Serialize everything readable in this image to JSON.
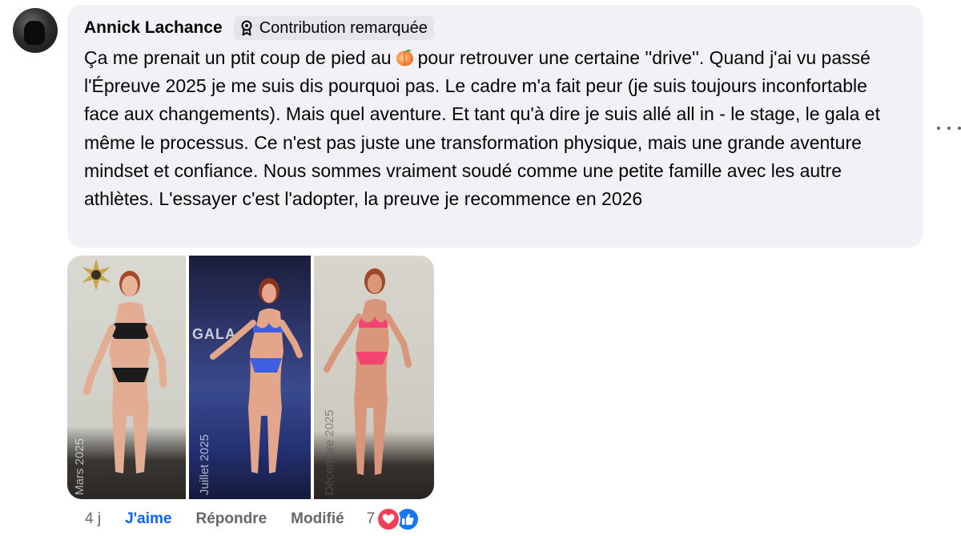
{
  "comment": {
    "author": "Annick Lachance",
    "badge_label": "Contribution remarquée",
    "text_before_emoji": "Ça me prenait un ptit coup de pied au",
    "emoji": "peach-emoji",
    "text_after_emoji": "pour retrouver une certaine ''drive''. Quand j'ai vu passé l'Épreuve 2025 je me suis dis pourquoi pas. Le cadre m'a fait peur (je suis toujours inconfortable face aux changements). Mais quel aventure. Et tant qu'à dire je suis allé all in - le stage, le gala et même le processus. Ce n'est pas juste une transformation physique, mais une grande aventure mindset et confiance. Nous sommes vraiment soudé comme une petite famille avec les autre athlètes. L'essayer c'est l'adopter, la preuve je recommence en 2026"
  },
  "photo": {
    "panels": [
      {
        "caption": "Mars 2025",
        "outfit_color": "#1b1b1b"
      },
      {
        "caption": "Juillet 2025",
        "outfit_color": "#3e5fe0",
        "sign_text": "GALA"
      },
      {
        "caption": "Décembre 2025",
        "outfit_color": "#f2446e"
      }
    ]
  },
  "actions": {
    "time": "4 j",
    "like_label": "J'aime",
    "reply_label": "Répondre",
    "edited_label": "Modifié",
    "reaction_count": "7"
  },
  "colors": {
    "bubble": "#f0f2f5",
    "badge": "#e4e6eb",
    "link_blue": "#0866ff",
    "secondary_text": "#65676b",
    "love": "#f33e58",
    "like": "#1877f2"
  },
  "icons": [
    "avatar",
    "badge-ribbon-icon",
    "more-options-icon",
    "heart-reaction-icon",
    "like-reaction-icon"
  ]
}
